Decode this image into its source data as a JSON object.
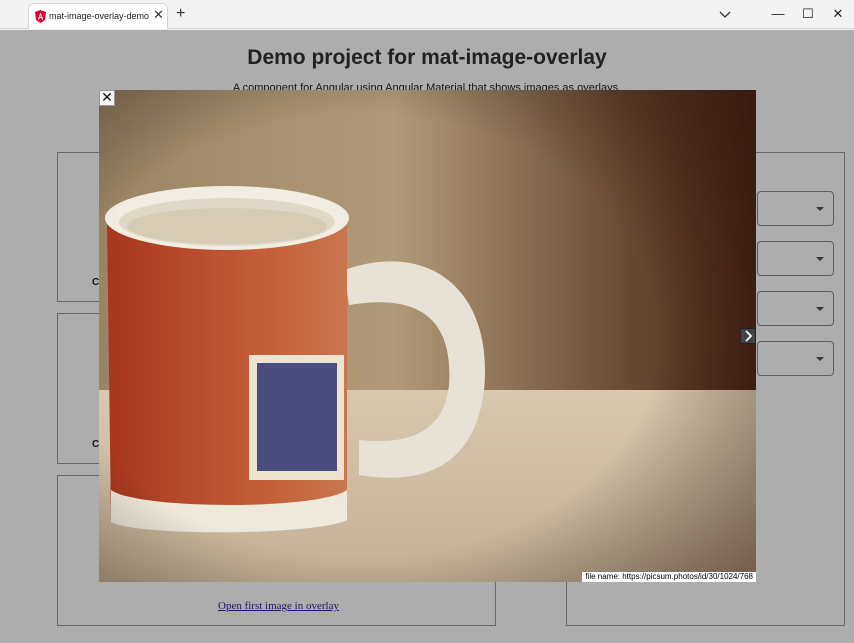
{
  "browser": {
    "tab_title": "mat-image-overlay-demo",
    "tab_close": "✕",
    "new_tab": "+",
    "minimize": "—",
    "maximize": "☐",
    "close": "✕"
  },
  "page": {
    "title": "Demo project for mat-image-overlay",
    "subtitle": "A component for Angular using Angular Material that shows images as overlays.",
    "card1_text": "C",
    "card2_text": "C",
    "open_link": "Open first image in overlay"
  },
  "overlay": {
    "close_label": "✕",
    "caption": "file name: https://picsum.photos/id/30/1024/768",
    "image_alt": "Mug with Cuba stamp design"
  },
  "colors": {
    "accent": "#3b1a9a",
    "backdrop": "rgba(0,0,0,0.32)"
  }
}
